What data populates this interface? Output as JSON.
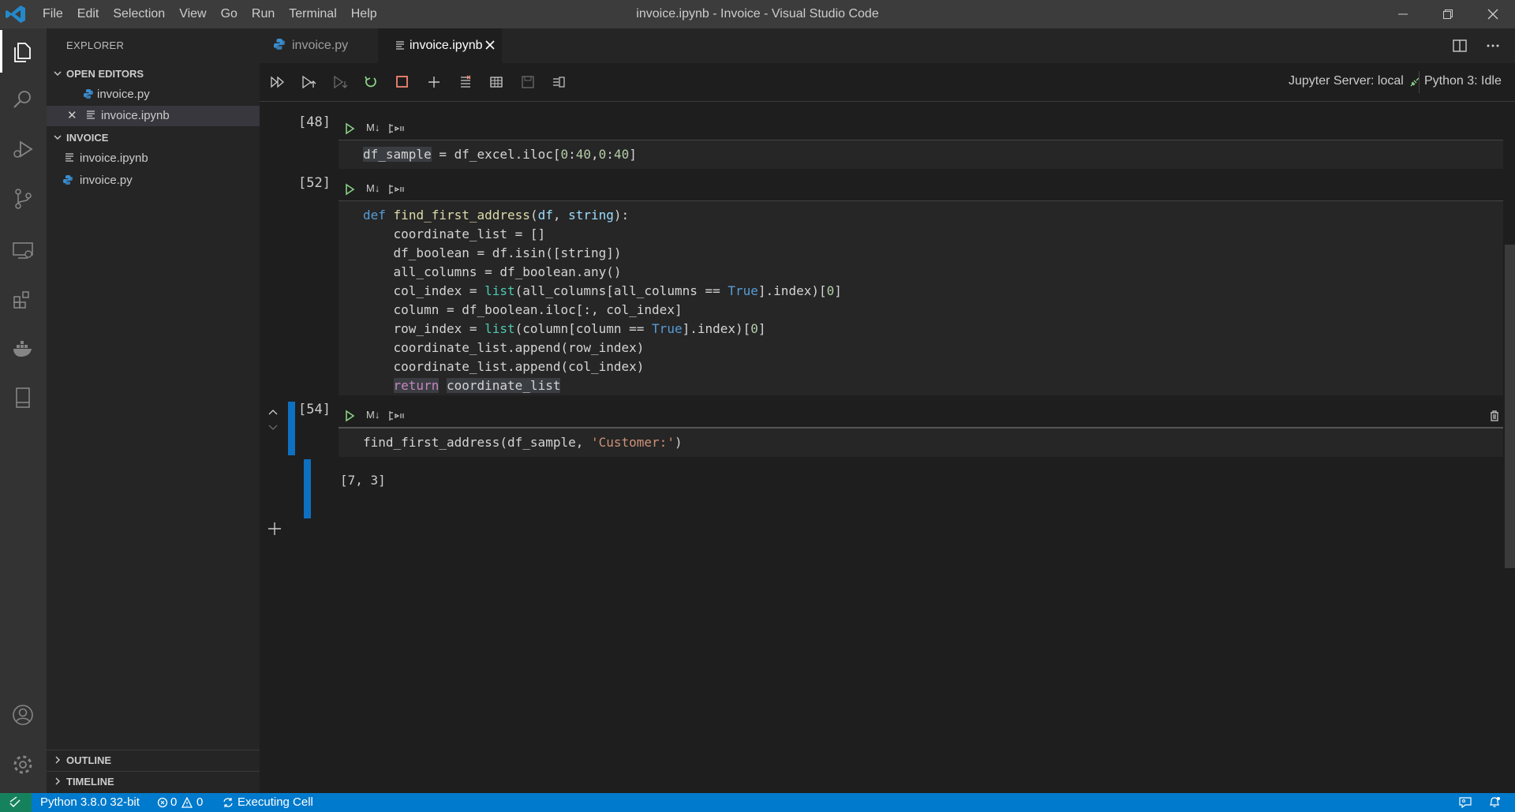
{
  "window": {
    "title": "invoice.ipynb - Invoice - Visual Studio Code",
    "menu": [
      "File",
      "Edit",
      "Selection",
      "View",
      "Go",
      "Run",
      "Terminal",
      "Help"
    ]
  },
  "sidebar": {
    "title": "EXPLORER",
    "open_editors_label": "OPEN EDITORS",
    "open_editors": [
      {
        "label": "invoice.py",
        "icon": "python-file-icon"
      },
      {
        "label": "invoice.ipynb",
        "icon": "notebook-file-icon"
      }
    ],
    "folder_label": "INVOICE",
    "files": [
      {
        "label": "invoice.ipynb",
        "icon": "notebook-file-icon"
      },
      {
        "label": "invoice.py",
        "icon": "python-file-icon"
      }
    ],
    "outline_label": "OUTLINE",
    "timeline_label": "TIMELINE"
  },
  "tabs": [
    {
      "label": "invoice.py",
      "active": false
    },
    {
      "label": "invoice.ipynb",
      "active": true
    }
  ],
  "toolbar": {
    "server_label": "Jupyter Server: local",
    "kernel_label": "Python 3: Idle"
  },
  "cells": [
    {
      "exec": "[48]",
      "md_label": "M↓"
    },
    {
      "exec": "[52]",
      "md_label": "M↓"
    },
    {
      "exec": "[54]",
      "md_label": "M↓"
    }
  ],
  "output": {
    "text": "[7, 3]"
  },
  "status": {
    "python": "Python 3.8.0 32-bit",
    "errors": "0",
    "warnings": "0",
    "activity": "Executing Cell"
  },
  "colors": {
    "accent": "#007acc",
    "remote": "#16825d",
    "run_green": "#89d185",
    "stop_red": "#f48771"
  }
}
